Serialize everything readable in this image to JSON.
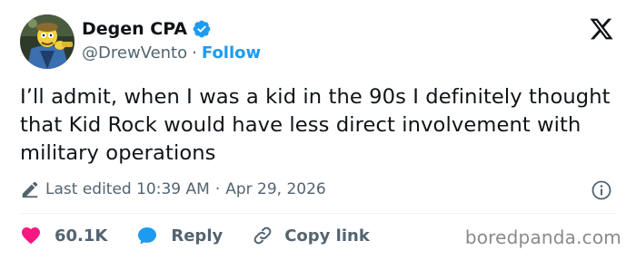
{
  "author": {
    "display_name": "Degen CPA",
    "handle": "@DrewVento",
    "separator": "·",
    "follow_label": "Follow",
    "verified": true
  },
  "tweet": {
    "text": "I’ll admit, when I was a kid in the 90s I definitely thought that Kid Rock would have less direct involvement with military operations"
  },
  "meta": {
    "edited_label": "Last edited 10:39 AM",
    "separator": "·",
    "date": "Apr 29, 2026"
  },
  "actions": {
    "like_count": "60.1K",
    "reply_label": "Reply",
    "copy_link_label": "Copy link"
  },
  "watermark": "boredpanda.com",
  "colors": {
    "accent": "#1d9bf0",
    "like": "#f91880",
    "text": "#0f1419",
    "muted": "#536471"
  },
  "icons": [
    "x-logo-icon",
    "verified-badge-icon",
    "edit-pencil-icon",
    "info-icon",
    "heart-icon",
    "reply-bubble-icon",
    "link-icon"
  ]
}
